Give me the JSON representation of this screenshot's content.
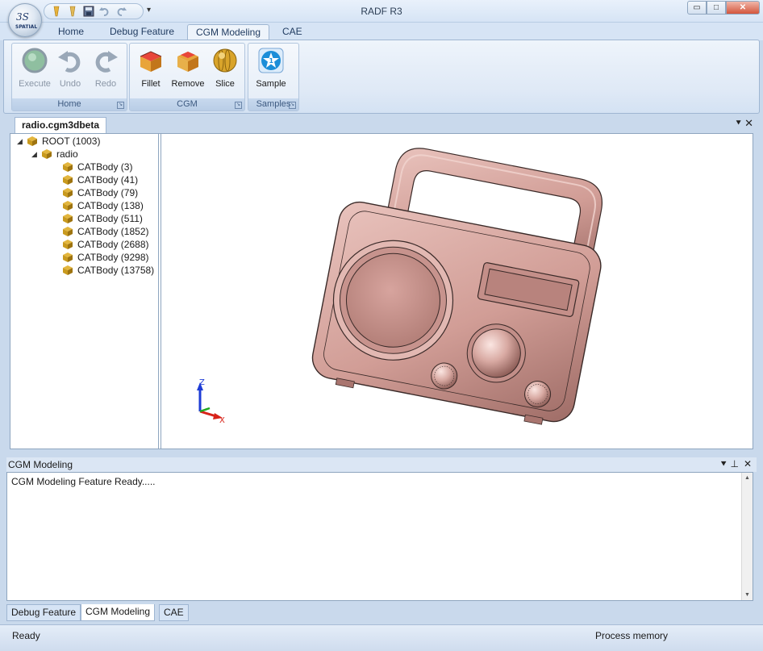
{
  "window": {
    "title": "RADF R3",
    "min_glyph": "▭",
    "max_glyph": "□",
    "close_glyph": "✕"
  },
  "app_menu": {
    "logo_text": "SPATIAL"
  },
  "quick_access": {
    "dropdown_glyph": "▾"
  },
  "ribbon": {
    "tabs": [
      {
        "label": "Home"
      },
      {
        "label": "Debug Feature"
      },
      {
        "label": "CGM Modeling"
      },
      {
        "label": "CAE"
      }
    ],
    "active_tab": "CGM Modeling",
    "groups": {
      "home": {
        "label": "Home",
        "buttons": {
          "execute": "Execute",
          "undo": "Undo",
          "redo": "Redo"
        }
      },
      "cgm": {
        "label": "CGM",
        "buttons": {
          "fillet": "Fillet",
          "remove": "Remove",
          "slice": "Slice"
        }
      },
      "samples": {
        "label": "Samples",
        "buttons": {
          "sample": "Sample"
        }
      }
    }
  },
  "document": {
    "tab_label": "radio.cgm3dbeta",
    "tree": {
      "root": "ROOT (1003)",
      "child": "radio",
      "bodies": [
        "CATBody (3)",
        "CATBody (41)",
        "CATBody (79)",
        "CATBody (138)",
        "CATBody (511)",
        "CATBody (1852)",
        "CATBody (2688)",
        "CATBody (9298)",
        "CATBody (13758)"
      ]
    },
    "axes": {
      "z": "Z",
      "x": "X"
    }
  },
  "output": {
    "title": "CGM Modeling",
    "message": "CGM Modeling Feature Ready.....",
    "bottom_tabs": [
      "Debug Feature",
      "CGM Modeling",
      "CAE"
    ],
    "active_bottom_tab": "CGM Modeling"
  },
  "status": {
    "left": "Ready",
    "right": "Process memory"
  },
  "colors": {
    "ribbon_bg": "#dfe9f6",
    "model_color": "#d9a8a2",
    "cube_gold": "#c99a1e"
  }
}
